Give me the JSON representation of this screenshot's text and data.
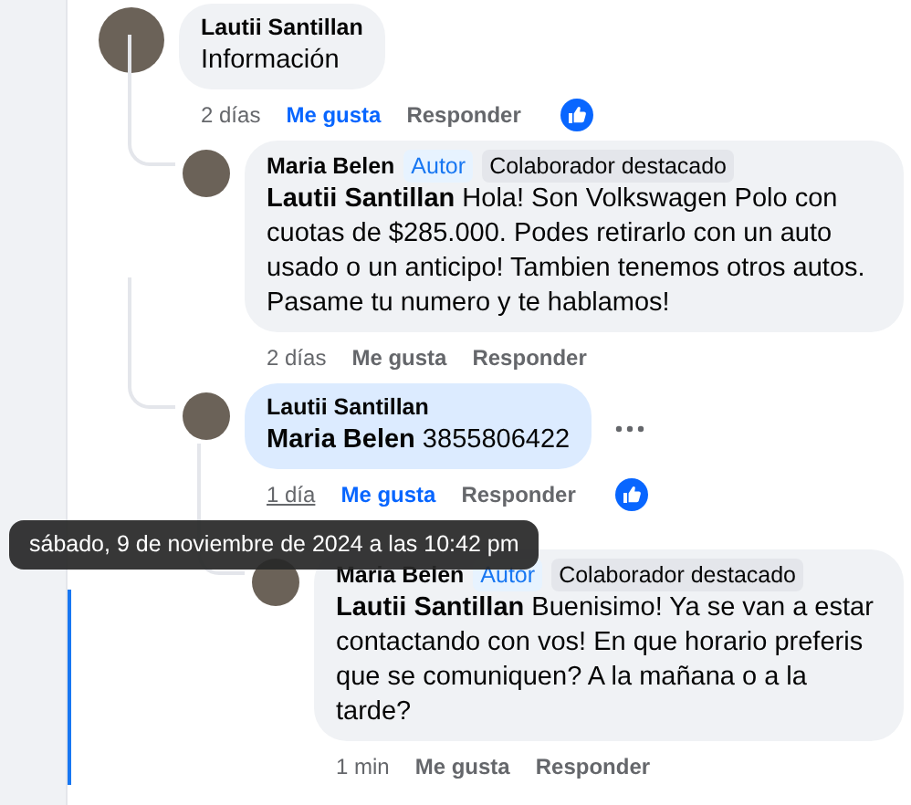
{
  "comments": [
    {
      "author": "Lautii Santillan",
      "text": "Información",
      "highlighted": false,
      "time": "2 días",
      "time_hovered": false,
      "like_label": "Me gusta",
      "liked": true,
      "reply_label": "Responder",
      "reaction_shown": true,
      "more_shown": false,
      "children": [
        {
          "author": "Maria Belen",
          "text": "**Lautii Santillan** Hola! Son Volkswagen Polo con cuotas de $285.000. Podes retirarlo con un auto usado o un anticipo! Tambien tenemos otros autos. Pasame tu numero y te hablamos!",
          "highlighted": false,
          "time": "2 días",
          "time_hovered": false,
          "like_label": "Me gusta",
          "liked": false,
          "reply_label": "Responder",
          "reaction_shown": false,
          "more_shown": false,
          "badges": [
            {
              "label": "Autor",
              "kind": "author"
            },
            {
              "label": "Colaborador destacado",
              "kind": "contributor"
            }
          ]
        },
        {
          "author": "Lautii Santillan",
          "text": "**Maria Belen** 3855806422",
          "highlighted": true,
          "time": "1 día",
          "time_hovered": true,
          "like_label": "Me gusta",
          "liked": true,
          "reply_label": "Responder",
          "reaction_shown": true,
          "more_shown": true,
          "children": [
            {
              "author": "Maria Belen",
              "text": "**Lautii Santillan** Buenisimo! Ya se van a estar contactando con vos! En que horario preferis que se comuniquen? A la mañana o a la tarde?",
              "highlighted": false,
              "time": "1 min",
              "time_hovered": false,
              "like_label": "Me gusta",
              "liked": false,
              "reply_label": "Responder",
              "reaction_shown": false,
              "more_shown": false,
              "badges": [
                {
                  "label": "Autor",
                  "kind": "author"
                },
                {
                  "label": "Colaborador destacado",
                  "kind": "contributor"
                }
              ]
            }
          ]
        }
      ]
    }
  ],
  "tooltip": {
    "text": "sábado, 9 de noviembre de 2024 a las 10:42 pm"
  }
}
